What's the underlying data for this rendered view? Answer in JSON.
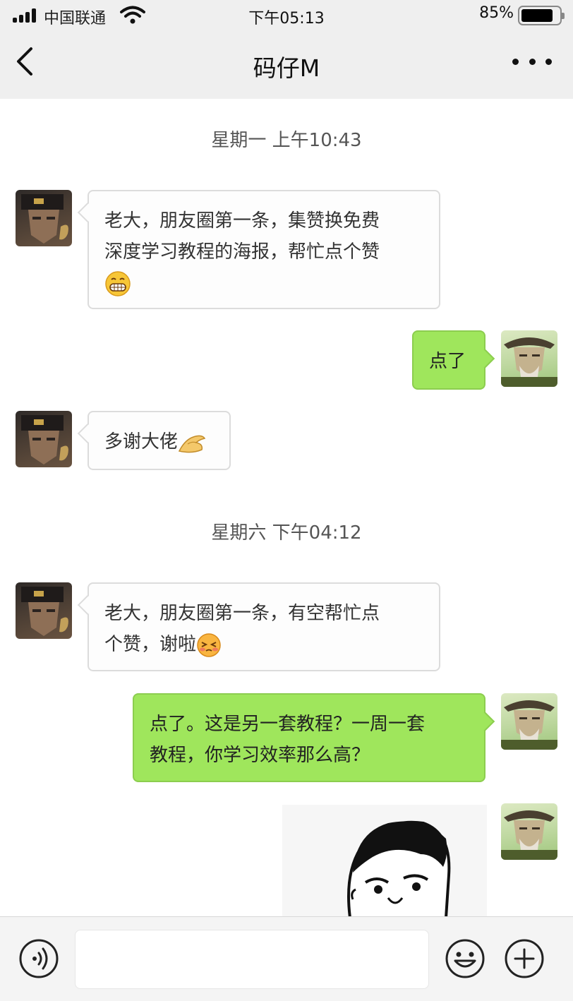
{
  "status_bar": {
    "carrier": "中国联通",
    "time": "下午05:13",
    "battery_percent": "85%",
    "battery_level": 0.85
  },
  "header": {
    "title": "码仔M"
  },
  "messages": [
    {
      "type": "timestamp",
      "text": "星期一 上午10:43"
    },
    {
      "type": "incoming",
      "lines": [
        "老大，朋友圈第一条，集赞换免费",
        "深度学习教程的海报，帮忙点个赞"
      ],
      "emoji": "grin-emoji"
    },
    {
      "type": "outgoing",
      "lines": [
        "点了"
      ]
    },
    {
      "type": "incoming",
      "lines": [
        "多谢大佬"
      ],
      "emoji": "fist-bump-emoji"
    },
    {
      "type": "timestamp",
      "text": "星期六 下午04:12"
    },
    {
      "type": "incoming",
      "lines": [
        "老大，朋友圈第一条，有空帮忙点",
        "个赞，谢啦"
      ],
      "emoji": "shy-emoji"
    },
    {
      "type": "outgoing",
      "lines": [
        "点了。这是另一套教程？一周一套",
        "教程，你学习效率那么高？"
      ]
    },
    {
      "type": "outgoing-sticker",
      "sticker": "meme-face-sticker"
    }
  ],
  "input_bar": {
    "value": "",
    "icons": [
      "voice-icon",
      "emoji-icon",
      "plus-icon"
    ]
  },
  "colors": {
    "top_bar": "#efefef",
    "outgoing_bubble": "#9fe65c",
    "incoming_bubble": "#fdfdfd"
  }
}
